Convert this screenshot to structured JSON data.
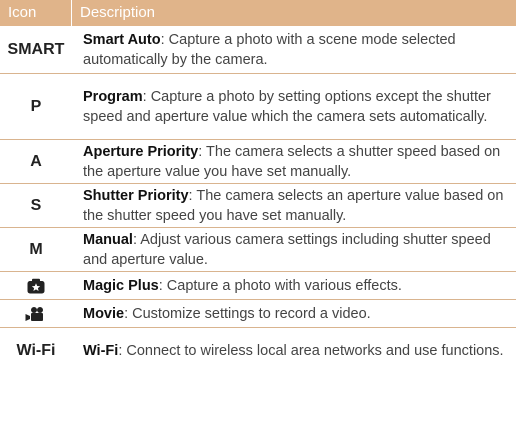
{
  "header": {
    "icon_col": "Icon",
    "desc_col": "Description"
  },
  "rows": [
    {
      "icon_text": "SMART",
      "name": "Smart Auto",
      "text": ": Capture a photo with a scene mode selected automatically by the camera."
    },
    {
      "icon_text": "P",
      "name": "Program",
      "text": ": Capture a photo by setting options except the shutter speed and aperture value which the camera sets automatically."
    },
    {
      "icon_text": "A",
      "name": "Aperture Priority",
      "text": ": The camera selects a shutter speed based on the aperture value you have set manually."
    },
    {
      "icon_text": "S",
      "name": "Shutter Priority",
      "text": ": The camera selects an aperture value based on the shutter speed you have set manually."
    },
    {
      "icon_text": "M",
      "name": "Manual",
      "text": ": Adjust various camera settings including shutter speed and aperture value."
    },
    {
      "icon": "magic-plus-icon",
      "name": "Magic Plus",
      "text": ": Capture a photo with various effects."
    },
    {
      "icon": "movie-icon",
      "name": "Movie",
      "text": ": Customize settings to record a video."
    },
    {
      "icon_text": "Wi-Fi",
      "name": "Wi-Fi",
      "text": ": Connect to wireless local area networks and use functions."
    }
  ],
  "colors": {
    "header_bg": "#e0b48a",
    "divider": "#d9b48f"
  }
}
